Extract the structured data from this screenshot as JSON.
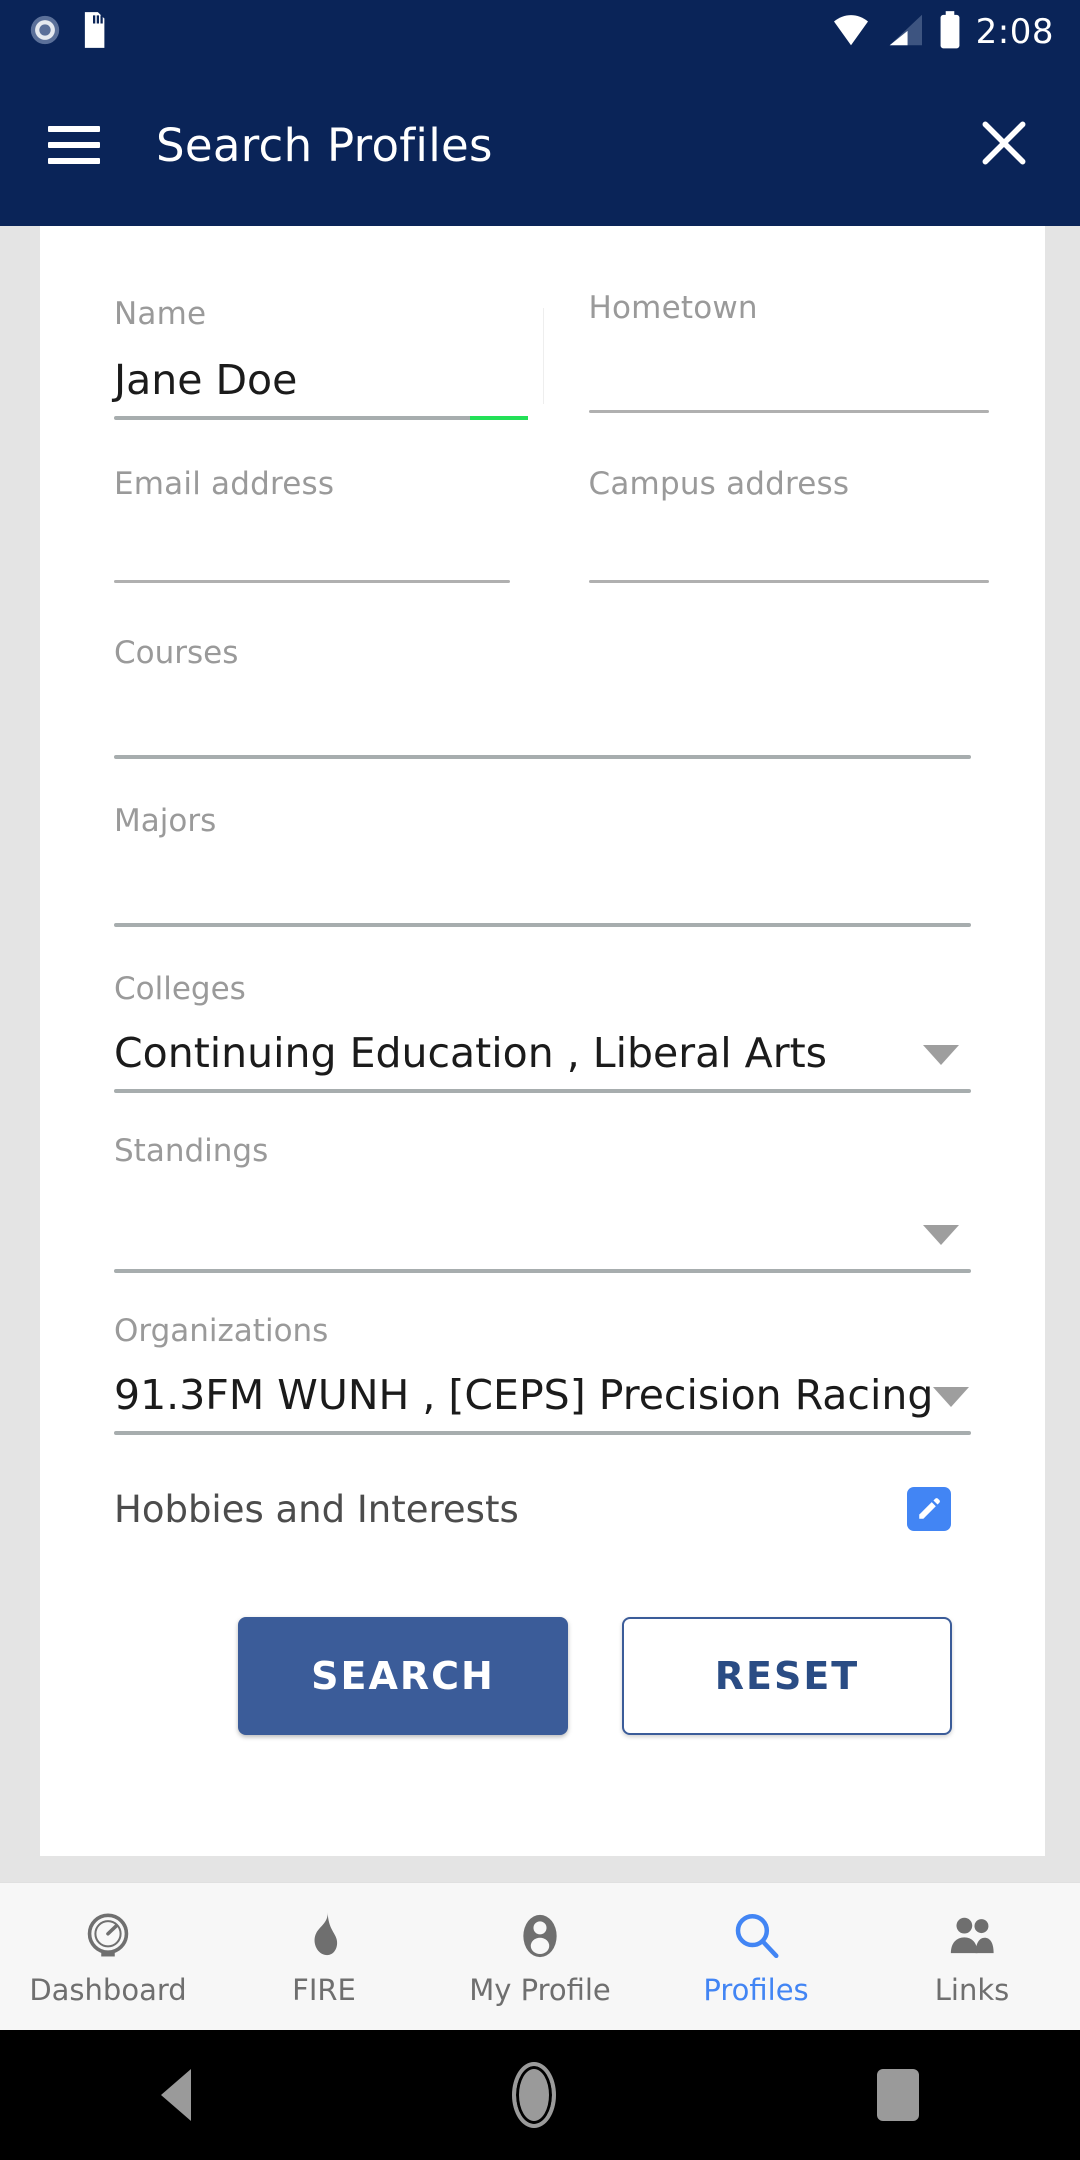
{
  "status_bar": {
    "time": "2:08",
    "icons": [
      "sim-card-icon",
      "sd-card-icon",
      "wifi-icon",
      "cellular-signal-icon",
      "battery-icon"
    ]
  },
  "app_bar": {
    "title": "Search Profiles",
    "menu_icon": "hamburger-menu-icon",
    "close_icon": "close-icon",
    "background": "#0a2458"
  },
  "form": {
    "name": {
      "label": "Name",
      "value": "Jane Doe",
      "placeholder": ""
    },
    "hometown": {
      "label": "Hometown",
      "value": "",
      "placeholder": ""
    },
    "email": {
      "label": "Email address",
      "value": "",
      "placeholder": ""
    },
    "campus_address": {
      "label": "Campus address",
      "value": "",
      "placeholder": ""
    },
    "courses": {
      "label": "Courses",
      "value": "",
      "placeholder": ""
    },
    "majors": {
      "label": "Majors",
      "value": "",
      "placeholder": ""
    },
    "colleges": {
      "label": "Colleges",
      "value": "Continuing Education , Liberal Arts"
    },
    "standings": {
      "label": "Standings",
      "value": ""
    },
    "organizations": {
      "label": "Organizations",
      "value": "91.3FM WUNH , [CEPS] Precision Racing"
    },
    "hobbies": {
      "label": "Hobbies and Interests",
      "edit_icon": "pencil-edit-icon"
    }
  },
  "actions": {
    "search_label": "SEARCH",
    "reset_label": "RESET",
    "search_color": "#3b5c99",
    "reset_color": "#2a4c84"
  },
  "bottom_nav": {
    "active_color": "#4285f4",
    "items": [
      {
        "label": "Dashboard",
        "icon": "speedometer-icon",
        "active": false
      },
      {
        "label": "FIRE",
        "icon": "flame-icon",
        "active": false
      },
      {
        "label": "My Profile",
        "icon": "person-icon",
        "active": false
      },
      {
        "label": "Profiles",
        "icon": "search-icon",
        "active": true
      },
      {
        "label": "Links",
        "icon": "people-icon",
        "active": false
      }
    ]
  },
  "android_nav": {
    "back": "back-triangle-icon",
    "home": "home-circle-icon",
    "recents": "recents-square-icon"
  }
}
